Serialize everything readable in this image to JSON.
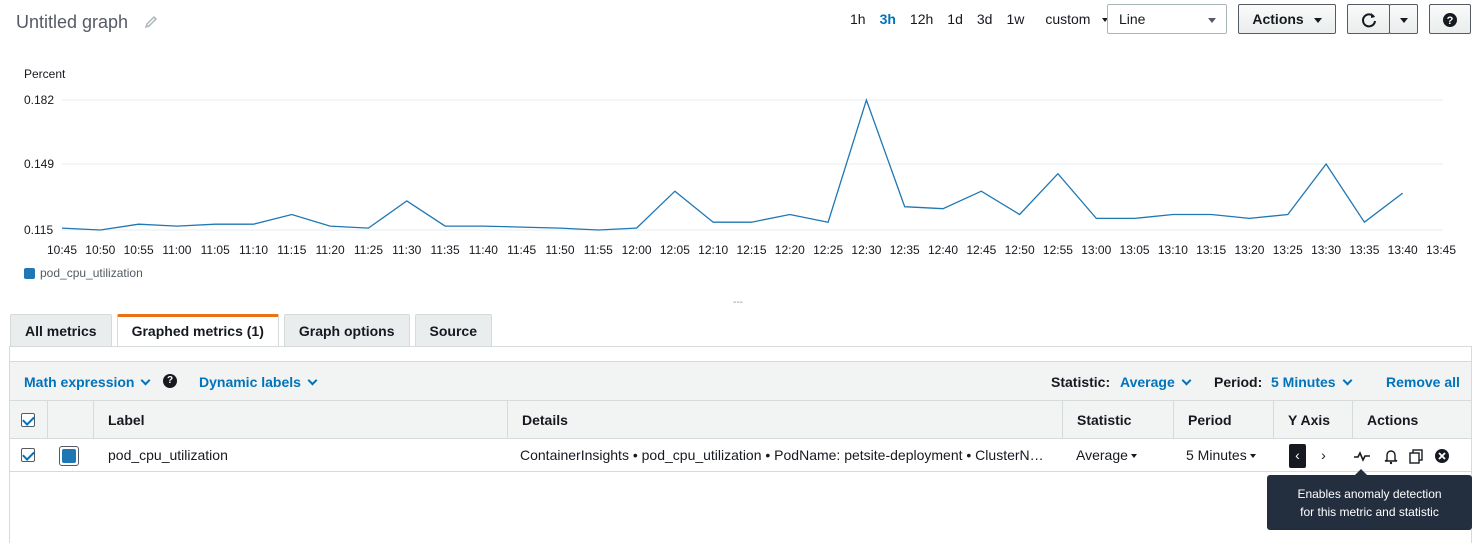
{
  "header": {
    "title": "Untitled graph",
    "time_ranges": [
      "1h",
      "3h",
      "12h",
      "1d",
      "3d",
      "1w"
    ],
    "active_range": "3h",
    "custom_label": "custom",
    "chart_type_value": "Line",
    "actions_label": "Actions"
  },
  "chart_data": {
    "type": "line",
    "ylabel": "Percent",
    "yticks": [
      "0.182",
      "0.149",
      "0.115"
    ],
    "ylim": [
      0.115,
      0.182
    ],
    "x": [
      "10:45",
      "10:50",
      "10:55",
      "11:00",
      "11:05",
      "11:10",
      "11:15",
      "11:20",
      "11:25",
      "11:30",
      "11:35",
      "11:40",
      "11:45",
      "11:50",
      "11:55",
      "12:00",
      "12:05",
      "12:10",
      "12:15",
      "12:20",
      "12:25",
      "12:30",
      "12:35",
      "12:40",
      "12:45",
      "12:50",
      "12:55",
      "13:00",
      "13:05",
      "13:10",
      "13:15",
      "13:20",
      "13:25",
      "13:30",
      "13:35",
      "13:40",
      "13:45"
    ],
    "series": [
      {
        "name": "pod_cpu_utilization",
        "color": "#1f77b4",
        "values": [
          0.116,
          0.115,
          0.118,
          0.117,
          0.118,
          0.118,
          0.123,
          0.117,
          0.116,
          0.13,
          0.117,
          0.117,
          0.1165,
          0.116,
          0.115,
          0.116,
          0.135,
          0.119,
          0.119,
          0.123,
          0.119,
          0.182,
          0.127,
          0.126,
          0.135,
          0.123,
          0.144,
          0.121,
          0.121,
          0.123,
          0.123,
          0.121,
          0.123,
          0.149,
          0.119,
          0.134,
          null
        ]
      }
    ],
    "grid": true,
    "legend": "bottom-left"
  },
  "tabs": [
    "All metrics",
    "Graphed metrics (1)",
    "Graph options",
    "Source"
  ],
  "active_tab": "Graphed metrics (1)",
  "toolbar": {
    "math_expression": "Math expression",
    "dynamic_labels": "Dynamic labels",
    "statistic_label": "Statistic:",
    "statistic_value": "Average",
    "period_label": "Period:",
    "period_value": "5 Minutes",
    "remove_all": "Remove all"
  },
  "table": {
    "headers": {
      "label": "Label",
      "details": "Details",
      "statistic": "Statistic",
      "period": "Period",
      "y_axis": "Y Axis",
      "actions": "Actions"
    },
    "rows": [
      {
        "label": "pod_cpu_utilization",
        "details": "ContainerInsights • pod_cpu_utilization • PodName: petsite-deployment • ClusterN…",
        "statistic": "Average",
        "period": "5 Minutes",
        "color": "#1f77b4"
      }
    ]
  },
  "tooltip": {
    "line1": "Enables anomaly detection",
    "line2": "for this metric and statistic"
  }
}
